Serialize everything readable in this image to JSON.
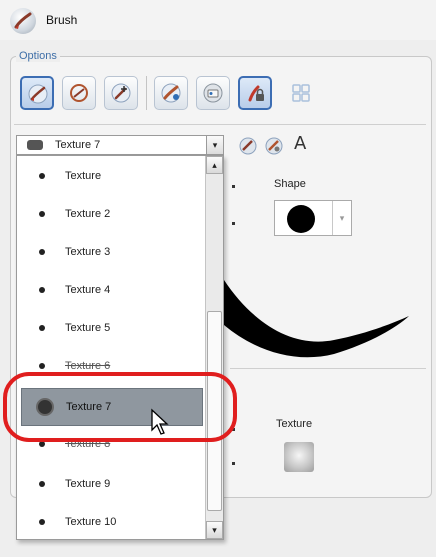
{
  "header": {
    "title": "Brush",
    "icon": "brush-icon"
  },
  "options": {
    "label": "Options",
    "tools": [
      {
        "name": "brush-tool-button",
        "icon": "brush-icon",
        "active": true
      },
      {
        "name": "rotate-tool-button",
        "icon": "rotate-icon",
        "active": false
      },
      {
        "name": "add-brush-tool-button",
        "icon": "add-brush-icon",
        "active": false
      },
      {
        "name": "paint-tool-button",
        "icon": "paint-icon",
        "active": false
      },
      {
        "name": "preset-tool-button",
        "icon": "preset-icon",
        "active": false
      },
      {
        "name": "lock-tool-button",
        "icon": "lock-icon",
        "active": true
      },
      {
        "name": "grid-tool-button",
        "icon": "grid-icon",
        "active": false
      }
    ]
  },
  "texture_combo": {
    "selected": "Texture 7",
    "arrow": "▾"
  },
  "texture_icons": {
    "glyph": "A"
  },
  "texture_list": {
    "items": [
      "Texture",
      "Texture 2",
      "Texture 3",
      "Texture 4",
      "Texture 5",
      "Texture 6",
      "Texture 7",
      "Texture 8",
      "Texture 9",
      "Texture 10"
    ],
    "selected_index": 6,
    "scroll_up": "▴",
    "scroll_down": "▾"
  },
  "shape": {
    "label": "Shape",
    "arrow": "▾"
  },
  "texture_preview": {
    "label": "Texture"
  },
  "colors": {
    "highlight": "#e01e1e",
    "accent": "#3c6db3",
    "selected_row": "#8f979f"
  }
}
